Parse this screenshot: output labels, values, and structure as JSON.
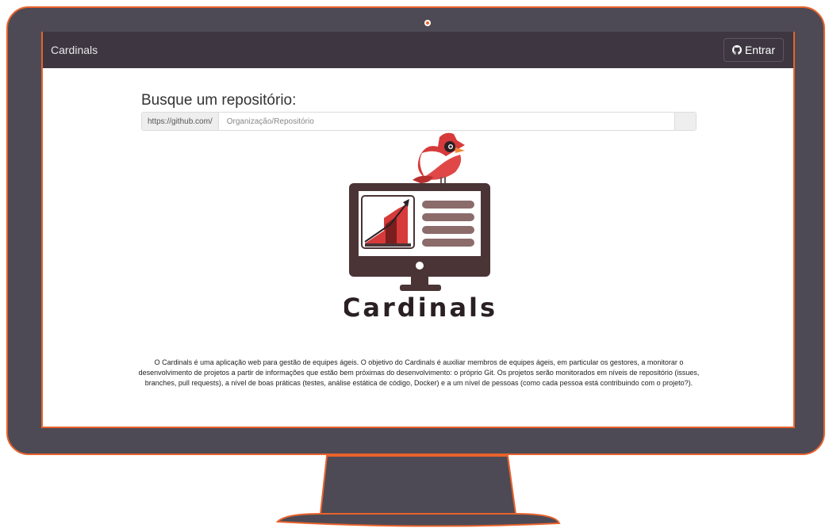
{
  "navbar": {
    "brand": "Cardinals",
    "login_label": "Entrar"
  },
  "search": {
    "title": "Busque um repositório:",
    "prefix": "https://github.com/",
    "placeholder": "Organização/Repositório",
    "value": ""
  },
  "logo": {
    "wordmark": "Cardinals"
  },
  "description": "O Cardinals é uma aplicação web para gestão de equipes ágeis. O objetivo do Cardinals é auxiliar membros de equipes ágeis, em particular os gestores, a monitorar o desenvolvimento de projetos a partir de informações que estão bem próximas do desenvolvimento: o próprio Git. Os projetos serão monitorados em níveis de repositório (issues, branches, pull requests), a nível de boas práticas (testes, análise estática de código, Docker) e a um nível de pessoas (como cada pessoa está contribuindo com o projeto?).",
  "icons": {
    "login": "github-icon"
  },
  "colors": {
    "frame": "#4d4a55",
    "accent": "#e8632c",
    "navbar": "#3e3741",
    "cardinal_red": "#d63a3a",
    "logo_monitor": "#4a3436"
  }
}
